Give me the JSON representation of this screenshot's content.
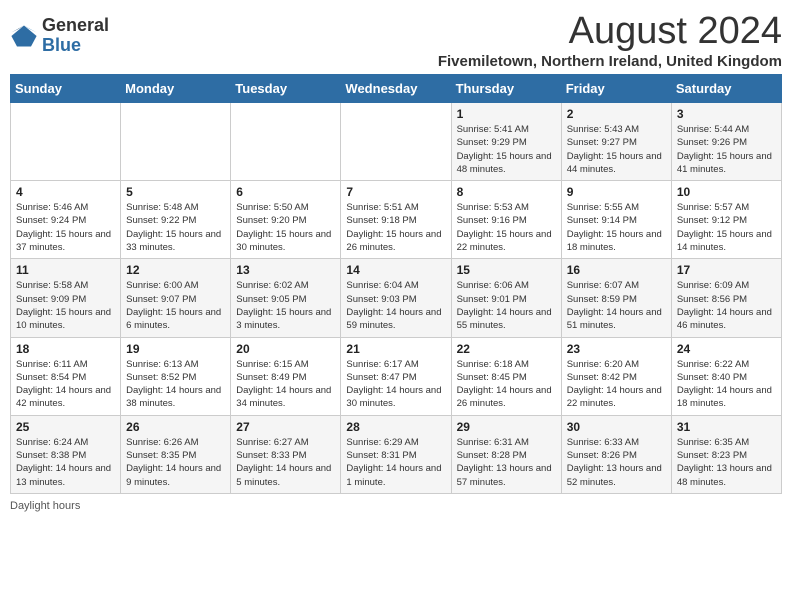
{
  "header": {
    "logo_general": "General",
    "logo_blue": "Blue",
    "main_title": "August 2024",
    "subtitle": "Fivemiletown, Northern Ireland, United Kingdom"
  },
  "days_of_week": [
    "Sunday",
    "Monday",
    "Tuesday",
    "Wednesday",
    "Thursday",
    "Friday",
    "Saturday"
  ],
  "weeks": [
    [
      {
        "day": "",
        "info": ""
      },
      {
        "day": "",
        "info": ""
      },
      {
        "day": "",
        "info": ""
      },
      {
        "day": "",
        "info": ""
      },
      {
        "day": "1",
        "info": "Sunrise: 5:41 AM\nSunset: 9:29 PM\nDaylight: 15 hours and 48 minutes."
      },
      {
        "day": "2",
        "info": "Sunrise: 5:43 AM\nSunset: 9:27 PM\nDaylight: 15 hours and 44 minutes."
      },
      {
        "day": "3",
        "info": "Sunrise: 5:44 AM\nSunset: 9:26 PM\nDaylight: 15 hours and 41 minutes."
      }
    ],
    [
      {
        "day": "4",
        "info": "Sunrise: 5:46 AM\nSunset: 9:24 PM\nDaylight: 15 hours and 37 minutes."
      },
      {
        "day": "5",
        "info": "Sunrise: 5:48 AM\nSunset: 9:22 PM\nDaylight: 15 hours and 33 minutes."
      },
      {
        "day": "6",
        "info": "Sunrise: 5:50 AM\nSunset: 9:20 PM\nDaylight: 15 hours and 30 minutes."
      },
      {
        "day": "7",
        "info": "Sunrise: 5:51 AM\nSunset: 9:18 PM\nDaylight: 15 hours and 26 minutes."
      },
      {
        "day": "8",
        "info": "Sunrise: 5:53 AM\nSunset: 9:16 PM\nDaylight: 15 hours and 22 minutes."
      },
      {
        "day": "9",
        "info": "Sunrise: 5:55 AM\nSunset: 9:14 PM\nDaylight: 15 hours and 18 minutes."
      },
      {
        "day": "10",
        "info": "Sunrise: 5:57 AM\nSunset: 9:12 PM\nDaylight: 15 hours and 14 minutes."
      }
    ],
    [
      {
        "day": "11",
        "info": "Sunrise: 5:58 AM\nSunset: 9:09 PM\nDaylight: 15 hours and 10 minutes."
      },
      {
        "day": "12",
        "info": "Sunrise: 6:00 AM\nSunset: 9:07 PM\nDaylight: 15 hours and 6 minutes."
      },
      {
        "day": "13",
        "info": "Sunrise: 6:02 AM\nSunset: 9:05 PM\nDaylight: 15 hours and 3 minutes."
      },
      {
        "day": "14",
        "info": "Sunrise: 6:04 AM\nSunset: 9:03 PM\nDaylight: 14 hours and 59 minutes."
      },
      {
        "day": "15",
        "info": "Sunrise: 6:06 AM\nSunset: 9:01 PM\nDaylight: 14 hours and 55 minutes."
      },
      {
        "day": "16",
        "info": "Sunrise: 6:07 AM\nSunset: 8:59 PM\nDaylight: 14 hours and 51 minutes."
      },
      {
        "day": "17",
        "info": "Sunrise: 6:09 AM\nSunset: 8:56 PM\nDaylight: 14 hours and 46 minutes."
      }
    ],
    [
      {
        "day": "18",
        "info": "Sunrise: 6:11 AM\nSunset: 8:54 PM\nDaylight: 14 hours and 42 minutes."
      },
      {
        "day": "19",
        "info": "Sunrise: 6:13 AM\nSunset: 8:52 PM\nDaylight: 14 hours and 38 minutes."
      },
      {
        "day": "20",
        "info": "Sunrise: 6:15 AM\nSunset: 8:49 PM\nDaylight: 14 hours and 34 minutes."
      },
      {
        "day": "21",
        "info": "Sunrise: 6:17 AM\nSunset: 8:47 PM\nDaylight: 14 hours and 30 minutes."
      },
      {
        "day": "22",
        "info": "Sunrise: 6:18 AM\nSunset: 8:45 PM\nDaylight: 14 hours and 26 minutes."
      },
      {
        "day": "23",
        "info": "Sunrise: 6:20 AM\nSunset: 8:42 PM\nDaylight: 14 hours and 22 minutes."
      },
      {
        "day": "24",
        "info": "Sunrise: 6:22 AM\nSunset: 8:40 PM\nDaylight: 14 hours and 18 minutes."
      }
    ],
    [
      {
        "day": "25",
        "info": "Sunrise: 6:24 AM\nSunset: 8:38 PM\nDaylight: 14 hours and 13 minutes."
      },
      {
        "day": "26",
        "info": "Sunrise: 6:26 AM\nSunset: 8:35 PM\nDaylight: 14 hours and 9 minutes."
      },
      {
        "day": "27",
        "info": "Sunrise: 6:27 AM\nSunset: 8:33 PM\nDaylight: 14 hours and 5 minutes."
      },
      {
        "day": "28",
        "info": "Sunrise: 6:29 AM\nSunset: 8:31 PM\nDaylight: 14 hours and 1 minute."
      },
      {
        "day": "29",
        "info": "Sunrise: 6:31 AM\nSunset: 8:28 PM\nDaylight: 13 hours and 57 minutes."
      },
      {
        "day": "30",
        "info": "Sunrise: 6:33 AM\nSunset: 8:26 PM\nDaylight: 13 hours and 52 minutes."
      },
      {
        "day": "31",
        "info": "Sunrise: 6:35 AM\nSunset: 8:23 PM\nDaylight: 13 hours and 48 minutes."
      }
    ]
  ],
  "footer": {
    "daylight_hours_label": "Daylight hours"
  }
}
